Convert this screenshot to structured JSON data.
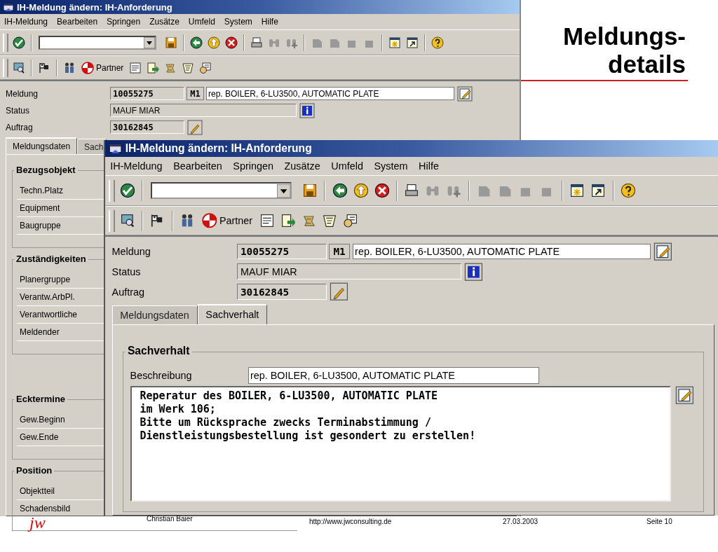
{
  "slide": {
    "title_lines": [
      "Meldungs-",
      "details"
    ]
  },
  "windows": [
    {
      "title": "IH-Meldung ändern: IH-Anforderung",
      "menu": [
        "IH-Meldung",
        "Bearbeiten",
        "Springen",
        "Zusätze",
        "Umfeld",
        "System",
        "Hilfe"
      ],
      "partner_label": "Partner",
      "fields": [
        {
          "label": "Meldung",
          "kind": "notification",
          "value": "10055275",
          "code": "M1",
          "description": "rep. BOILER, 6-LU3500, AUTOMATIC PLATE"
        },
        {
          "label": "Status",
          "kind": "status",
          "value": "MAUF MIAR"
        },
        {
          "label": "Auftrag",
          "kind": "order",
          "value": "30162845"
        }
      ],
      "tabs": [
        {
          "label": "Meldungsdaten",
          "selected": true
        },
        {
          "label": "Sach",
          "selected": false
        }
      ],
      "groups": [
        {
          "title": "Bezugsobjekt",
          "items": [
            "Techn.Platz",
            "Equipment",
            "Baugruppe"
          ]
        },
        {
          "title": "Zuständigkeiten",
          "items": [
            "Planergruppe",
            "Verantw.ArbPl.",
            "Verantwortliche",
            "Meldender"
          ]
        },
        {
          "title": "Ecktermine",
          "items": [
            "Gew.Beginn",
            "Gew.Ende"
          ]
        },
        {
          "title": "Position",
          "items": [
            "Objektteil",
            "Schadensbild"
          ]
        }
      ]
    },
    {
      "title": "IH-Meldung ändern: IH-Anforderung",
      "menu": [
        "IH-Meldung",
        "Bearbeiten",
        "Springen",
        "Zusätze",
        "Umfeld",
        "System",
        "Hilfe"
      ],
      "partner_label": "Partner",
      "fields": [
        {
          "label": "Meldung",
          "kind": "notification",
          "value": "10055275",
          "code": "M1",
          "description": "rep. BOILER, 6-LU3500, AUTOMATIC PLATE"
        },
        {
          "label": "Status",
          "kind": "status",
          "value": "MAUF MIAR"
        },
        {
          "label": "Auftrag",
          "kind": "order",
          "value": "30162845"
        }
      ],
      "tabs": [
        {
          "label": "Meldungsdaten",
          "selected": false
        },
        {
          "label": "Sachverhalt",
          "selected": true
        }
      ],
      "section": {
        "title": "Sachverhalt",
        "label": "Beschreibung",
        "value": "rep. BOILER, 6-LU3500, AUTOMATIC PLATE",
        "text_lines": [
          "Reperatur des BOILER, 6-LU3500, AUTOMATIC PLATE",
          "im Werk 106;",
          "Bitte um Rücksprache zwecks Terminabstimmung /",
          "Dienstleistungsbestellung ist gesondert zu erstellen!"
        ]
      }
    }
  ],
  "footer": {
    "logo": "jw",
    "author": "Christian Baier",
    "url": "http://www.jwconsulting.de",
    "date": "27.03.2003",
    "page": "Seite 10"
  }
}
